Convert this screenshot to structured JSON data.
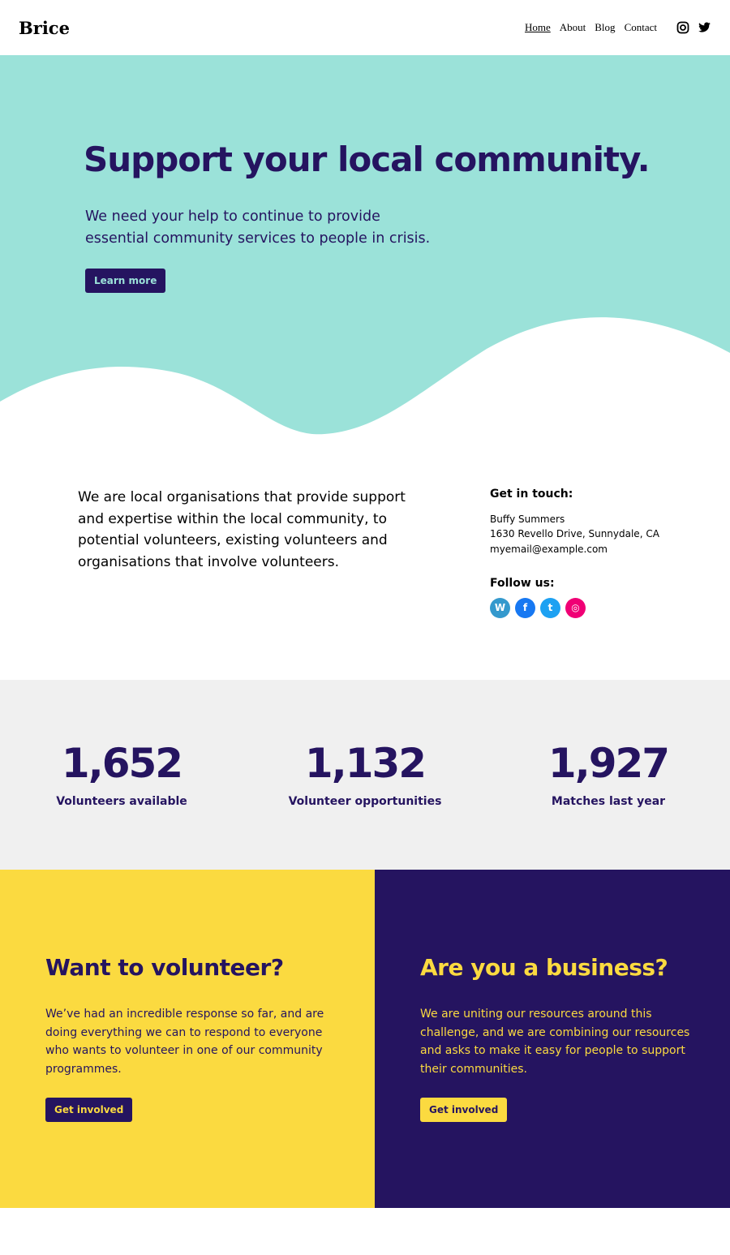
{
  "header": {
    "brand": "Brice",
    "nav": [
      "Home",
      "About",
      "Blog",
      "Contact"
    ],
    "social": [
      "instagram-icon",
      "twitter-icon"
    ]
  },
  "hero": {
    "title": "Support your local community.",
    "text": "We need your help to continue to provide essential community services to people in crisis.",
    "button": "Learn more",
    "color": "#9be2d9"
  },
  "about": {
    "text": "We are local organisations that provide support and expertise within the local community, to potential volunteers, existing volunteers and organisations that involve volunteers.",
    "contact_heading": "Get in touch:",
    "name": "Buffy Summers",
    "address": "1630 Revello Drive, Sunnydale, CA",
    "email": "myemail@example.com",
    "follow_heading": "Follow us:",
    "follow_icons": [
      "wordpress-icon",
      "facebook-icon",
      "twitter-icon",
      "instagram-icon"
    ]
  },
  "stats": [
    {
      "n": "1,652",
      "label": "Volunteers available"
    },
    {
      "n": "1,132",
      "label": "Volunteer opportunities"
    },
    {
      "n": "1,927",
      "label": "Matches last year"
    }
  ],
  "cta": [
    {
      "title": "Want to volunteer?",
      "text": "We’ve had an incredible response so far, and are doing everything we can to respond to everyone who wants to volunteer in one of our community programmes.",
      "button": "Get involved"
    },
    {
      "title": "Are you a business?",
      "text": "We are uniting our resources around this challenge, and we are combining our resources and asks to make it easy for people to support their communities.",
      "button": "Get involved"
    }
  ]
}
